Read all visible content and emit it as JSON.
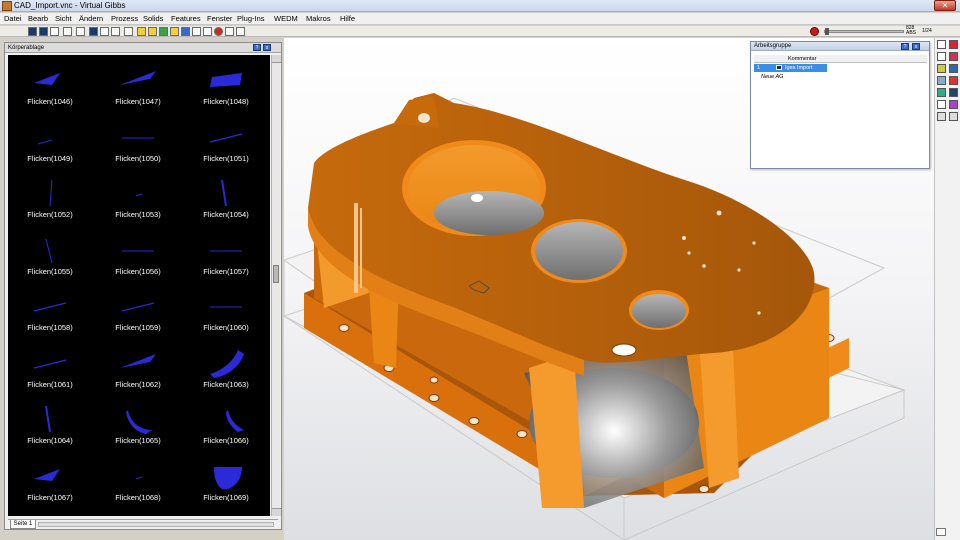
{
  "window": {
    "title": "CAD_Import.vnc - Virtual Gibbs",
    "close_glyph": "✕"
  },
  "menu": [
    {
      "label": "Datei"
    },
    {
      "label": "Bearb"
    },
    {
      "label": "Sicht"
    },
    {
      "label": "Ändern"
    },
    {
      "label": "Prozess"
    },
    {
      "label": "Solids"
    },
    {
      "label": "Features"
    },
    {
      "label": "Fenster"
    },
    {
      "label": "Plug-Ins"
    },
    {
      "label": "WEDM"
    },
    {
      "label": "Makros"
    },
    {
      "label": "Hilfe"
    }
  ],
  "toolbar": {
    "zoom_top": "828",
    "zoom_bottom": "ABS",
    "right_code": "1/24"
  },
  "left_panel": {
    "title": "Körperablage",
    "tab_label": "Seite 1",
    "items": [
      {
        "label": "Flicken(1046)",
        "shape": "wedge-left"
      },
      {
        "label": "Flicken(1047)",
        "shape": "wedge-right"
      },
      {
        "label": "Flicken(1048)",
        "shape": "quad"
      },
      {
        "label": "Flicken(1049)",
        "shape": "thin-dash"
      },
      {
        "label": "Flicken(1050)",
        "shape": "thin-line"
      },
      {
        "label": "Flicken(1051)",
        "shape": "thin-slant"
      },
      {
        "label": "Flicken(1052)",
        "shape": "vertical"
      },
      {
        "label": "Flicken(1053)",
        "shape": "dot"
      },
      {
        "label": "Flicken(1054)",
        "shape": "vertical-slant"
      },
      {
        "label": "Flicken(1055)",
        "shape": "thin-vert"
      },
      {
        "label": "Flicken(1056)",
        "shape": "thin-line"
      },
      {
        "label": "Flicken(1057)",
        "shape": "thin-line"
      },
      {
        "label": "Flicken(1058)",
        "shape": "thin-slant"
      },
      {
        "label": "Flicken(1059)",
        "shape": "thin-slant"
      },
      {
        "label": "Flicken(1060)",
        "shape": "thin-line"
      },
      {
        "label": "Flicken(1061)",
        "shape": "thin-slant"
      },
      {
        "label": "Flicken(1062)",
        "shape": "wedge-right"
      },
      {
        "label": "Flicken(1063)",
        "shape": "arc"
      },
      {
        "label": "Flicken(1064)",
        "shape": "vertical-slant"
      },
      {
        "label": "Flicken(1065)",
        "shape": "curl"
      },
      {
        "label": "Flicken(1066)",
        "shape": "curl-small"
      },
      {
        "label": "Flicken(1067)",
        "shape": "wedge-left"
      },
      {
        "label": "Flicken(1068)",
        "shape": "dot"
      },
      {
        "label": "Flicken(1069)",
        "shape": "half-disc"
      }
    ]
  },
  "work_window": {
    "title": "Arbeitsgruppe",
    "column_kommentar": "Kommentar",
    "row1_num": "1",
    "row1_label": "Iges Import",
    "row2_label": "Neue AG"
  },
  "colors": {
    "part_orange": "#d9740f",
    "part_dark": "#9c4e06",
    "accent_blue": "#3a6ac8",
    "selection": "#3a8ee6"
  },
  "icons": {
    "title": "virtual-gibbs-app-icon",
    "stop": "stop-icon"
  }
}
